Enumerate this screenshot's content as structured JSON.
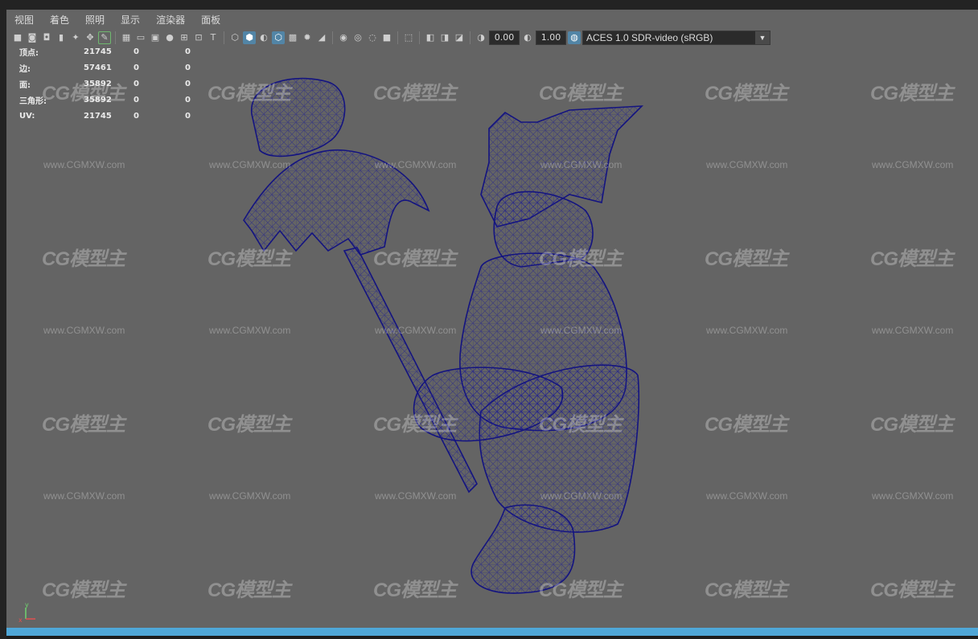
{
  "menubar": {
    "items": [
      "视图",
      "着色",
      "照明",
      "显示",
      "渲染器",
      "面板"
    ]
  },
  "toolbar": {
    "icons": [
      "camera-icon",
      "lock-camera-icon",
      "bookmark-icon",
      "select-camera-icon",
      "grease-pencil-icon",
      "grid-icon",
      "film-gate-icon",
      "resolution-gate-icon",
      "safe-action-icon",
      "field-chart-icon",
      "safe-title-icon",
      "wireframe-icon",
      "smooth-shade-icon",
      "textured-icon",
      "wireframe-on-shaded-icon",
      "xray-icon",
      "lights-icon",
      "shadows-icon",
      "ambient-occlusion-icon",
      "motion-blur-icon",
      "anti-alias-icon",
      "isolate-select-icon",
      "xray-joints-icon",
      "exposure-icon",
      "gamma-icon",
      "color-management-icon"
    ],
    "exposure_value": "0.00",
    "gamma_value": "1.00",
    "colorspace": "ACES 1.0 SDR-video (sRGB)",
    "colors": {
      "active": "#5285a6",
      "accent": "#6fb86f"
    }
  },
  "hud": {
    "rows": [
      {
        "label": "顶点:",
        "v1": "21745",
        "v2": "0",
        "v3": "0"
      },
      {
        "label": "边:",
        "v1": "57461",
        "v2": "0",
        "v3": "0"
      },
      {
        "label": "面:",
        "v1": "35892",
        "v2": "0",
        "v3": "0"
      },
      {
        "label": "三角形:",
        "v1": "35892",
        "v2": "0",
        "v3": "0"
      },
      {
        "label": "UV:",
        "v1": "21745",
        "v2": "0",
        "v3": "0"
      }
    ]
  },
  "watermark": {
    "logo": "CG模型主",
    "url": "www.CGMXW.com"
  },
  "viewport": {
    "camera": "persp",
    "background_color": "#646464",
    "wire_color": "#1a1a8c",
    "axis": {
      "x": "x",
      "y": "y"
    }
  }
}
